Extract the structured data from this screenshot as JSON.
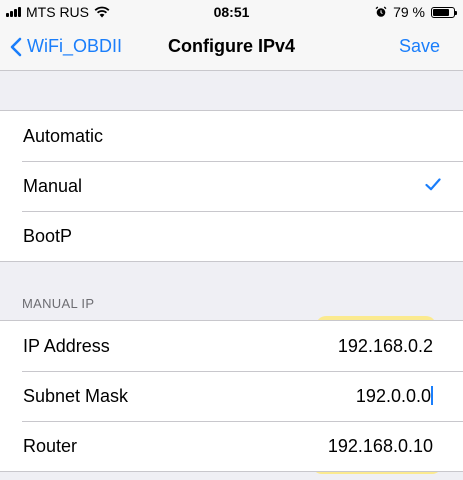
{
  "status_bar": {
    "carrier": "MTS RUS",
    "time": "08:51",
    "battery_percent": "79 %",
    "battery_level": 0.79,
    "icons": [
      "signal-icon",
      "wifi-icon",
      "alarm-icon",
      "battery-icon"
    ]
  },
  "nav": {
    "back_label": "WiFi_OBDII",
    "title": "Configure IPv4",
    "save_label": "Save"
  },
  "mode_options": [
    {
      "label": "Automatic",
      "selected": false
    },
    {
      "label": "Manual",
      "selected": true
    },
    {
      "label": "BootP",
      "selected": false
    }
  ],
  "manual_ip": {
    "header": "MANUAL IP",
    "fields": [
      {
        "label": "IP Address",
        "value": "192.168.0.2"
      },
      {
        "label": "Subnet Mask",
        "value": "192.0.0.0"
      },
      {
        "label": "Router",
        "value": "192.168.0.10"
      }
    ]
  },
  "colors": {
    "accent": "#1a7efb",
    "highlight": "#ffe86e",
    "background": "#efeff4"
  }
}
